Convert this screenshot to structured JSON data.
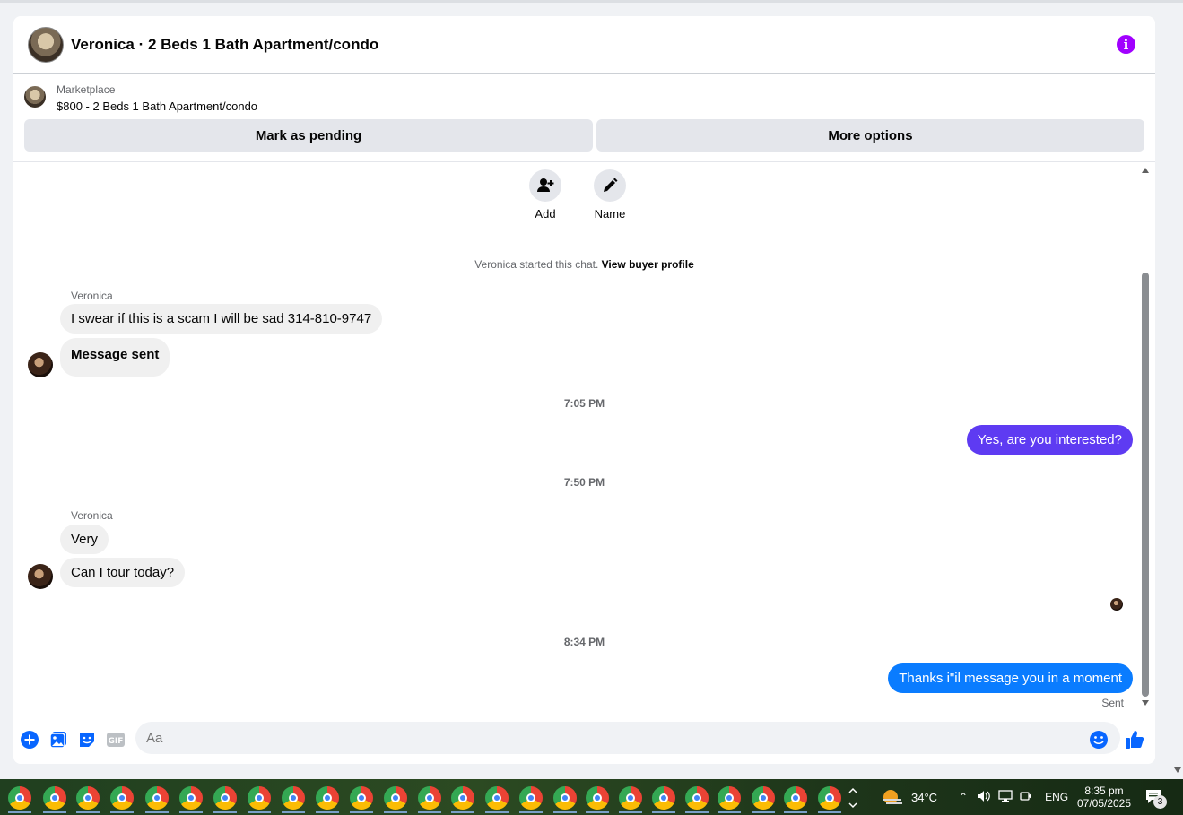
{
  "header": {
    "title": "Veronica · 2 Beds 1 Bath Apartment/condo",
    "info_icon": "info-icon"
  },
  "marketplace": {
    "label": "Marketplace",
    "listing": "$800 - 2 Beds 1 Bath Apartment/condo",
    "mark_pending": "Mark as pending",
    "more_options": "More options"
  },
  "actions": {
    "add": "Add",
    "name": "Name"
  },
  "system": {
    "started": "Veronica started this chat.",
    "view_profile": "View buyer profile"
  },
  "messages": {
    "sender1": "Veronica",
    "m1": "I swear if this is a scam I will be sad 314-810-9747",
    "m2": "Message sent",
    "t1": "7:05 PM",
    "m3": "Yes, are you interested?",
    "t2": "7:50 PM",
    "sender2": "Veronica",
    "m4": "Very",
    "m5": "Can I tour today?",
    "t3": "8:34 PM",
    "m6": "Thanks i\"il message you in a moment",
    "status": "Sent"
  },
  "composer": {
    "placeholder": "Aa"
  },
  "taskbar": {
    "temperature": "34°C",
    "language": "ENG",
    "time": "8:35 pm",
    "date": "07/05/2025",
    "notifications": "3"
  },
  "colors": {
    "accent_blue": "#0a7cff",
    "accent_purple": "#5e3bf2",
    "info_purple": "#a100ff"
  }
}
